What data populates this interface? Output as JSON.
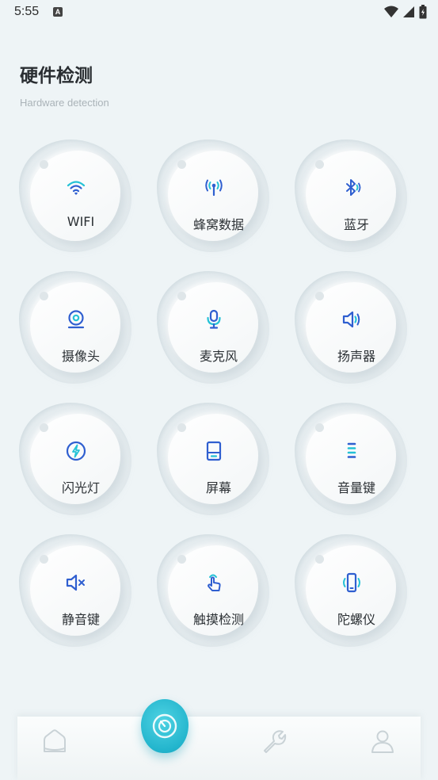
{
  "status": {
    "time": "5:55",
    "badge": "A"
  },
  "header": {
    "title": "硬件检测",
    "subtitle": "Hardware detection"
  },
  "tiles": [
    {
      "label": "WIFI",
      "icon": "wifi-icon"
    },
    {
      "label": "蜂窝数据",
      "icon": "cellular-antenna-icon"
    },
    {
      "label": "蓝牙",
      "icon": "bluetooth-icon"
    },
    {
      "label": "摄像头",
      "icon": "camera-icon"
    },
    {
      "label": "麦克风",
      "icon": "microphone-icon"
    },
    {
      "label": "扬声器",
      "icon": "speaker-icon"
    },
    {
      "label": "闪光灯",
      "icon": "flash-icon"
    },
    {
      "label": "屏幕",
      "icon": "screen-icon"
    },
    {
      "label": "音量键",
      "icon": "volume-key-icon"
    },
    {
      "label": "静音键",
      "icon": "mute-icon"
    },
    {
      "label": "触摸检测",
      "icon": "touch-hand-icon"
    },
    {
      "label": "陀螺仪",
      "icon": "gyroscope-icon"
    }
  ],
  "nav": {
    "items": [
      "home-icon",
      "scan-icon",
      "wrench-icon",
      "user-icon"
    ]
  },
  "colors": {
    "accent": "#29bdd3",
    "icon_blue": "#2f5fd0",
    "icon_cyan": "#25c2d6",
    "background": "#eef4f6"
  }
}
